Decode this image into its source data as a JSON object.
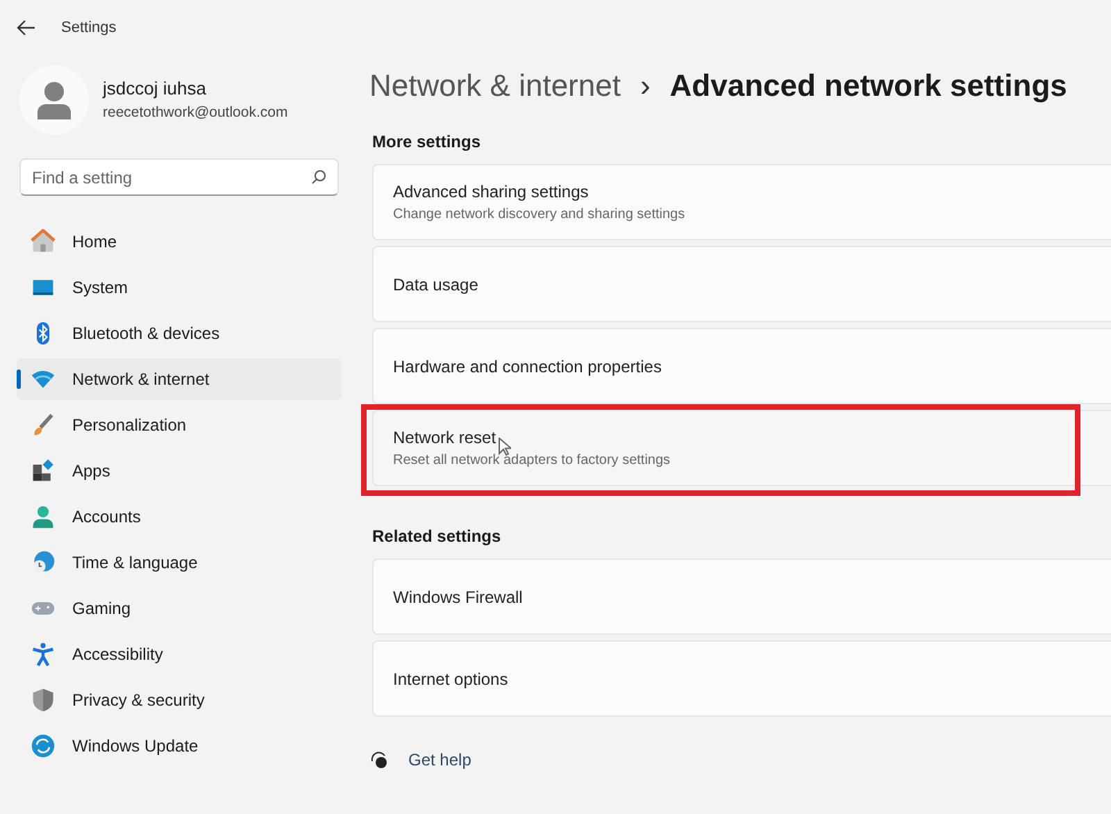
{
  "window": {
    "title": "Settings"
  },
  "profile": {
    "name": "jsdccoj iuhsa",
    "email": "reecetothwork@outlook.com"
  },
  "search": {
    "placeholder": "Find a setting"
  },
  "sidebar": {
    "items": [
      {
        "label": "Home",
        "selected": false
      },
      {
        "label": "System",
        "selected": false
      },
      {
        "label": "Bluetooth & devices",
        "selected": false
      },
      {
        "label": "Network & internet",
        "selected": true
      },
      {
        "label": "Personalization",
        "selected": false
      },
      {
        "label": "Apps",
        "selected": false
      },
      {
        "label": "Accounts",
        "selected": false
      },
      {
        "label": "Time & language",
        "selected": false
      },
      {
        "label": "Gaming",
        "selected": false
      },
      {
        "label": "Accessibility",
        "selected": false
      },
      {
        "label": "Privacy & security",
        "selected": false
      },
      {
        "label": "Windows Update",
        "selected": false
      }
    ]
  },
  "breadcrumb": {
    "parent": "Network & internet",
    "separator": "›",
    "current": "Advanced network settings"
  },
  "sections": [
    {
      "heading": "More settings",
      "items": [
        {
          "title": "Advanced sharing settings",
          "description": "Change network discovery and sharing settings",
          "hovered": false,
          "highlighted": false
        },
        {
          "title": "Data usage",
          "hovered": false,
          "highlighted": false
        },
        {
          "title": "Hardware and connection properties",
          "hovered": false,
          "highlighted": false
        },
        {
          "title": "Network reset",
          "description": "Reset all network adapters to factory settings",
          "hovered": true,
          "highlighted": true
        }
      ]
    },
    {
      "heading": "Related settings",
      "items": [
        {
          "title": "Windows Firewall",
          "hovered": false,
          "highlighted": false
        },
        {
          "title": "Internet options",
          "hovered": false,
          "highlighted": false
        }
      ]
    }
  ],
  "help": {
    "label": "Get help"
  }
}
